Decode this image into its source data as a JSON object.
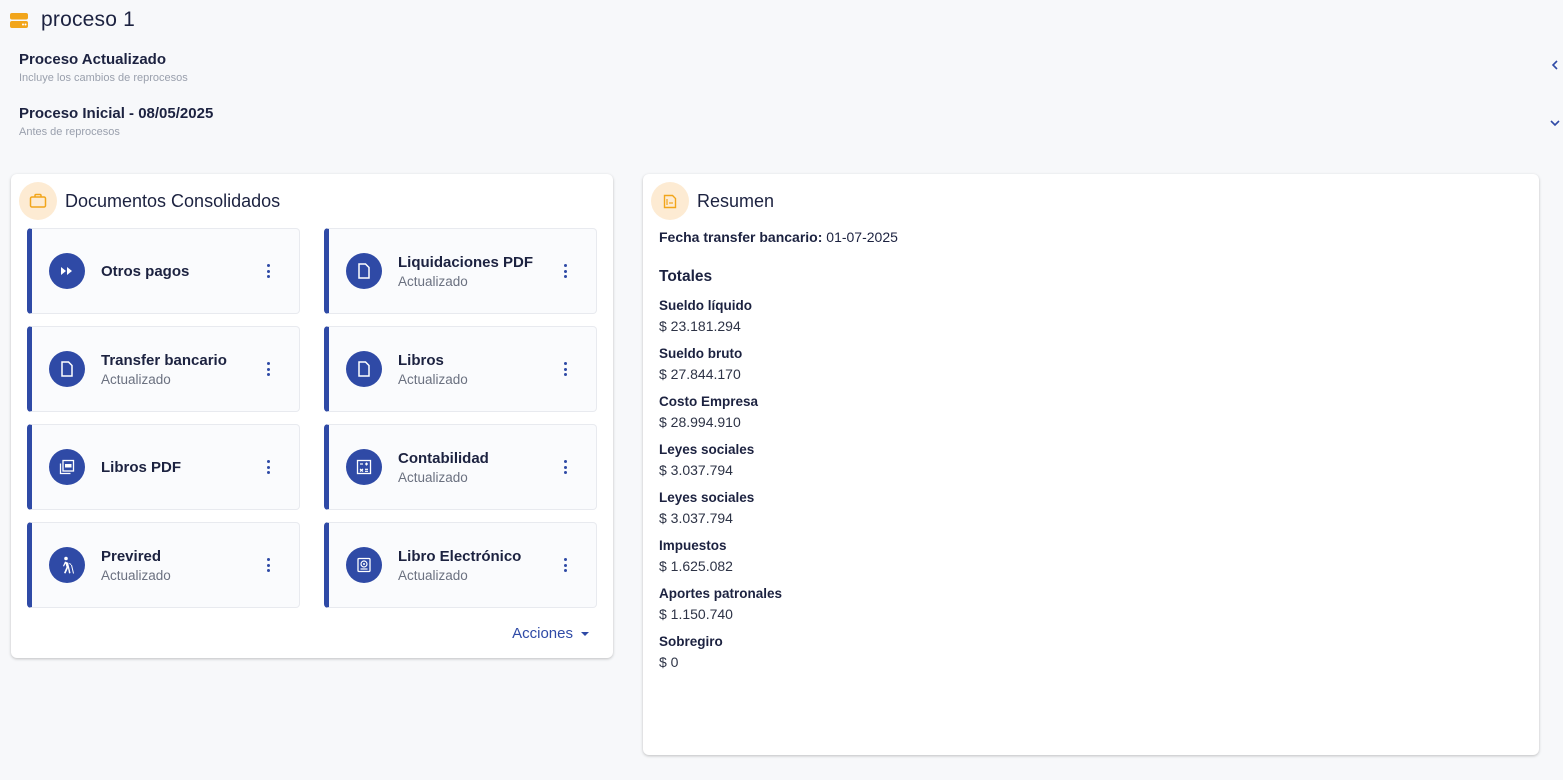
{
  "header": {
    "title": "proceso 1",
    "icon": "drive-icon"
  },
  "process_options": [
    {
      "title": "Proceso Actualizado",
      "subtitle": "Incluye los cambios de reprocesos",
      "chevron": "chevron-left-icon"
    },
    {
      "title": "Proceso Inicial - 08/05/2025",
      "subtitle": "Antes de reprocesos",
      "chevron": "chevron-down-icon"
    }
  ],
  "documents": {
    "title": "Documentos Consolidados",
    "icon": "briefcase-icon",
    "items": [
      {
        "name": "Otros pagos",
        "status": "",
        "icon": "fast-forward-icon"
      },
      {
        "name": "Liquidaciones PDF",
        "status": "Actualizado",
        "icon": "file-icon"
      },
      {
        "name": "Transfer bancario",
        "status": "Actualizado",
        "icon": "file-icon"
      },
      {
        "name": "Libros",
        "status": "Actualizado",
        "icon": "file-icon"
      },
      {
        "name": "Libros PDF",
        "status": "",
        "icon": "pdf-icon"
      },
      {
        "name": "Contabilidad",
        "status": "Actualizado",
        "icon": "calculator-icon"
      },
      {
        "name": "Previred",
        "status": "Actualizado",
        "icon": "person-walking-cane-icon"
      },
      {
        "name": "Libro Electrónico",
        "status": "Actualizado",
        "icon": "ebook-icon"
      }
    ],
    "actions_label": "Acciones"
  },
  "summary": {
    "title": "Resumen",
    "icon": "receipt-icon",
    "fecha_label": "Fecha transfer bancario:",
    "fecha_value": "01-07-2025",
    "totales_title": "Totales",
    "totales": [
      {
        "label": "Sueldo líquido",
        "value": "$ 23.181.294"
      },
      {
        "label": "Sueldo bruto",
        "value": "$ 27.844.170"
      },
      {
        "label": "Costo Empresa",
        "value": "$ 28.994.910"
      },
      {
        "label": "Leyes sociales",
        "value": "$ 3.037.794"
      },
      {
        "label": "Leyes sociales",
        "value": "$ 3.037.794"
      },
      {
        "label": "Impuestos",
        "value": "$ 1.625.082"
      },
      {
        "label": "Aportes patronales",
        "value": "$ 1.150.740"
      },
      {
        "label": "Sobregiro",
        "value": "$ 0"
      }
    ]
  },
  "colors": {
    "primary": "#2f4aa6",
    "accent": "#f2a51a",
    "accent_bg": "#fdebd3",
    "text": "#1c2240"
  }
}
